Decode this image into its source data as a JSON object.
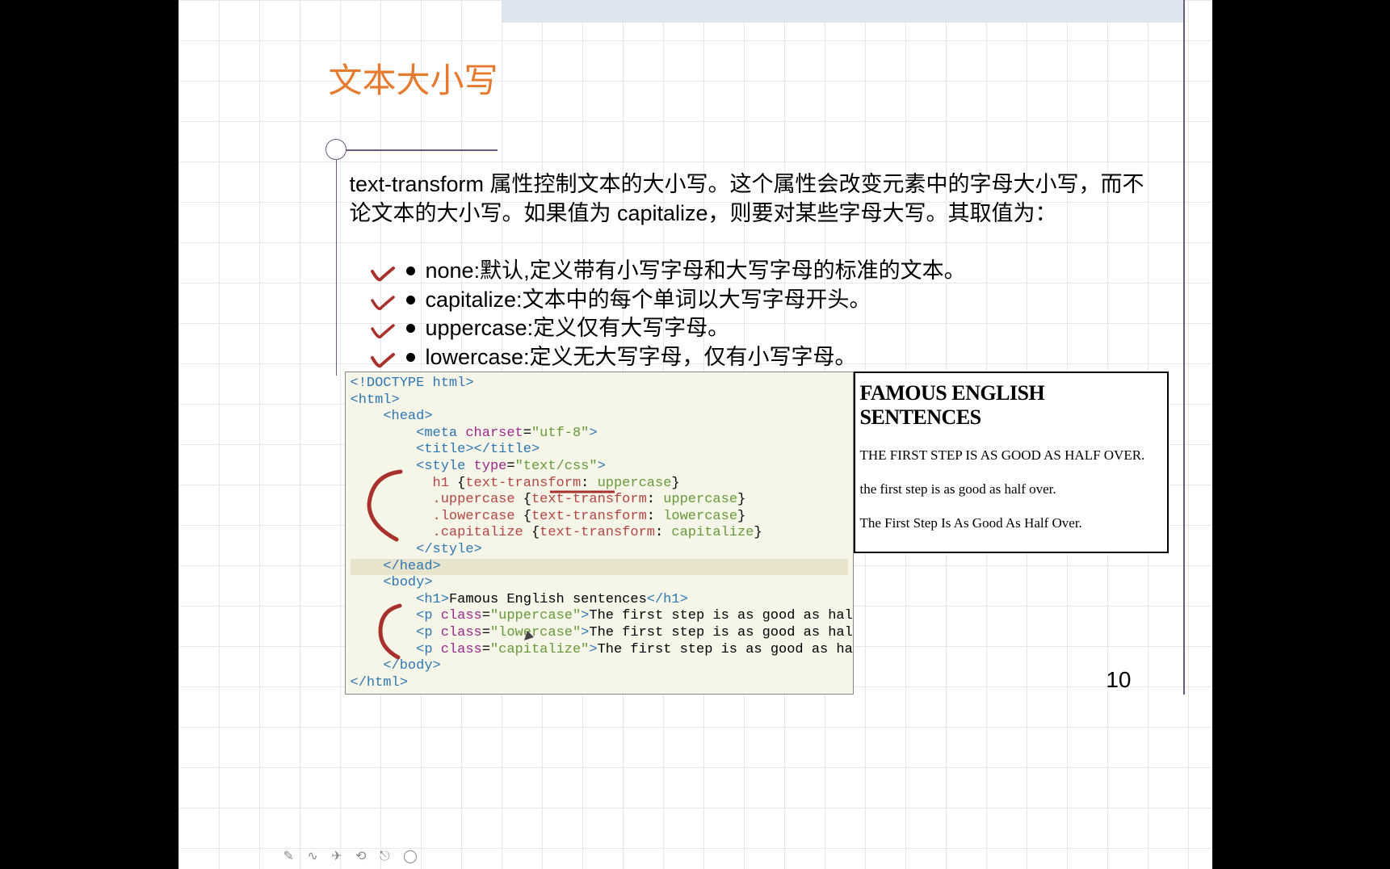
{
  "title": "文本大小写",
  "description": "text-transform 属性控制文本的大小写。这个属性会改变元素中的字母大小写，而不论文本的大小写。如果值为 capitalize，则要对某些字母大写。其取值为：",
  "bullets": [
    {
      "label": "none:默认,定义带有小写字母和大写字母的标准的文本。",
      "checked": true
    },
    {
      "label": "capitalize:文本中的每个单词以大写字母开头。",
      "checked": true
    },
    {
      "label": "uppercase:定义仅有大写字母。",
      "checked": true
    },
    {
      "label": "lowercase:定义无大写字母，仅有小写字母。",
      "checked": true
    }
  ],
  "code": {
    "doctype": "<!DOCTYPE html>",
    "open_html": "<html>",
    "open_head": "<head>",
    "meta": "<meta charset=\"utf-8\">",
    "title_tag": "<title></title>",
    "open_style": "<style type=\"text/css\">",
    "rule1": "h1 {text-transform: uppercase}",
    "rule2": ".uppercase {text-transform: uppercase}",
    "rule3": ".lowercase {text-transform: lowercase}",
    "rule4": ".capitalize {text-transform: capitalize}",
    "close_style": "</style>",
    "close_head": "</head>",
    "open_body": "<body>",
    "h1_line": "<h1>Famous English sentences</h1>",
    "p1": "<p class=\"uppercase\">The first step is as good as half over.</p>",
    "p2": "<p class=\"lowercase\">The first step is as good as half over.</p>",
    "p3": "<p class=\"capitalize\">The first step is as good as half over.</p>",
    "close_body": "</body>",
    "close_html": "</html>"
  },
  "output": {
    "heading": "FAMOUS ENGLISH SENTENCES",
    "line1": "THE FIRST STEP IS AS GOOD AS HALF OVER.",
    "line2": "the first step is as good as half over.",
    "line3": "The First Step Is As Good As Half Over."
  },
  "page_number": "10",
  "check_color": "#a8312c",
  "brace_color": "#a8312c"
}
